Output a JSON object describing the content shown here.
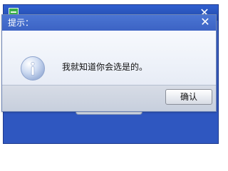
{
  "dialog": {
    "title": "提示：",
    "message": "我就知道你会选是的。",
    "ok_label": "确认",
    "close_label": "✕",
    "icon": "info-icon"
  },
  "background_window": {
    "close_label": "✕",
    "icon": "app-icon"
  },
  "colors": {
    "titlebar": "#3c63c4",
    "background_window": "#2f57c0",
    "dialog_body": "#eef2f9",
    "footer": "#c7cfdd"
  }
}
